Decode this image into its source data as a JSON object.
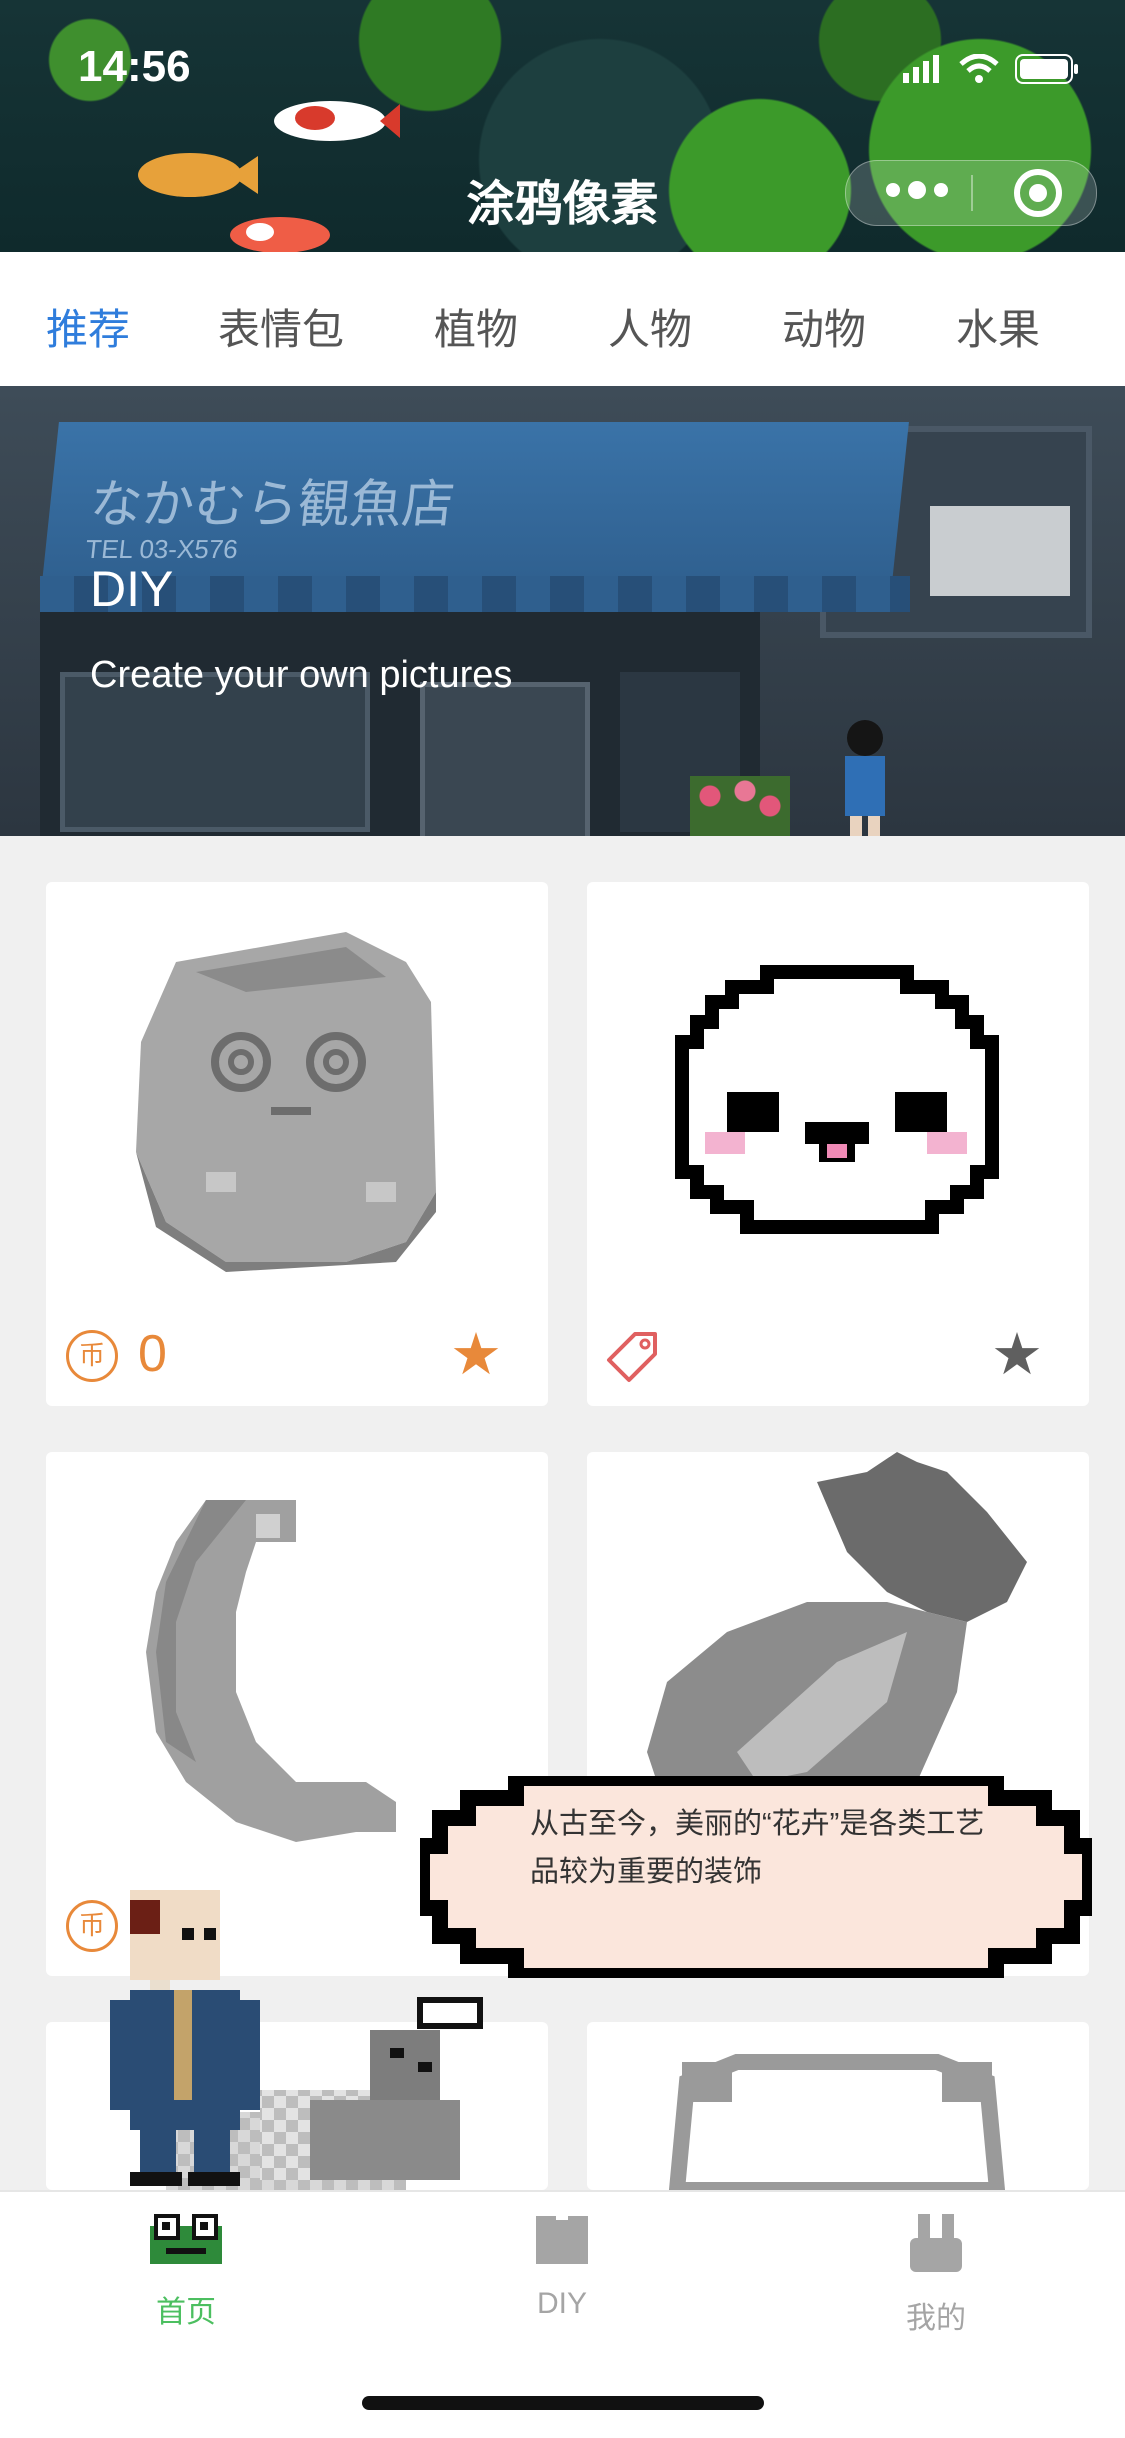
{
  "status_bar": {
    "time": "14:56"
  },
  "header": {
    "title": "涂鸦像素"
  },
  "tabs": [
    {
      "label": "推荐",
      "active": true
    },
    {
      "label": "表情包",
      "active": false
    },
    {
      "label": "植物",
      "active": false
    },
    {
      "label": "人物",
      "active": false
    },
    {
      "label": "动物",
      "active": false
    },
    {
      "label": "水果",
      "active": false
    }
  ],
  "banner": {
    "title": "DIY",
    "subtitle": "Create your own pictures",
    "sign_text": "なかむら観魚店",
    "sign_tel": "TEL 03-X576"
  },
  "cards": [
    {
      "art": "gray-face-egg",
      "coin_label": "币",
      "count": "0",
      "star": "orange"
    },
    {
      "art": "white-panda-face",
      "tag_icon": true,
      "star": "gray"
    },
    {
      "art": "gray-crescent-moon",
      "coin_label": "币",
      "star": "orange"
    },
    {
      "art": "gray-pineapple",
      "star": "orange"
    },
    {
      "art": "partial-item"
    },
    {
      "art": "partial-panda"
    }
  ],
  "bubble": {
    "text": "从古至今，美丽的“花卉”是各类工艺品较为重要的装饰"
  },
  "bottom_nav": [
    {
      "label": "首页",
      "icon": "frog-icon",
      "active": true
    },
    {
      "label": "DIY",
      "icon": "book-icon",
      "active": false
    },
    {
      "label": "我的",
      "icon": "rabbit-icon",
      "active": false
    }
  ],
  "colors": {
    "accent_blue": "#2f7ddc",
    "coin_orange": "#e8893a",
    "nav_green": "#4cbf60",
    "bubble_fill": "#fbe6dc"
  }
}
